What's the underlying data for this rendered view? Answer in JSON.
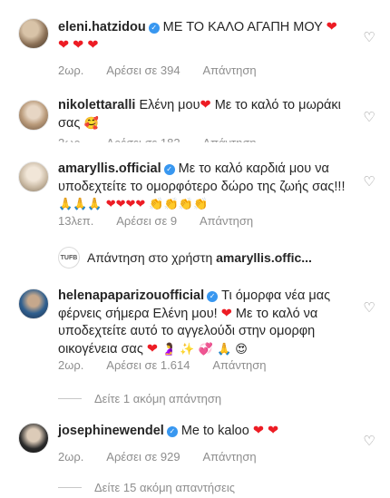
{
  "comments": [
    {
      "username": "eleni.hatzidou",
      "text": "ΜΕ ΤΟ ΚΑΛΟ ΑΓΑΠΗ ΜΟΥ",
      "emoji_trail": "❤ ❤❤❤",
      "time": "2ωρ.",
      "likes": "Αρέσει σε 394",
      "reply": "Απάντηση"
    },
    {
      "username": "nikolettaralli",
      "text": "Ελένη μου",
      "text2": "Με το καλό το μωράκι σας",
      "emoji_trail": "",
      "time": "2ωρ.",
      "likes": "Αρέσει σε 182",
      "reply": "Απάντηση"
    },
    {
      "username": "amaryllis.official",
      "text": "Με το καλό καρδιά μου να υποδεχτείτε το ομορφότερο δώρο της ζωής σας!!!",
      "emoji_trail": "🙏🙏🙏 ❤❤❤❤ 👏👏👏👏",
      "time": "13λεπ.",
      "likes": "Αρέσει σε 9",
      "reply": "Απάντηση"
    },
    {
      "username": "helenapaparizouofficial",
      "text": "Τι όμορφα νέα μας φέρνεις σήμερα Ελένη μου!",
      "text2": "Με το καλό να υποδεχτείτε αυτό το αγγελούδι στην ομορφη οικογένεια σας",
      "emoji_trail": "🤰 ✨ 💞 🙏 😍",
      "time": "2ωρ.",
      "likes": "Αρέσει σε 1.614",
      "reply": "Απάντηση"
    },
    {
      "username": "josephinewendel",
      "text": "Me to kaloo",
      "emoji_trail": "",
      "time": "2ωρ.",
      "likes": "Αρέσει σε 929",
      "reply": "Απάντηση"
    }
  ],
  "reply_prompt": {
    "prefix": "Απάντηση στο χρήστη",
    "target": "amaryllis.offic...",
    "avatar_label": "TUFB"
  },
  "more_replies": [
    "Δείτε 1 ακόμη απάντηση",
    "Δείτε 15 ακόμη απαντήσεις"
  ],
  "icons": {
    "like": "heart-outline-icon",
    "verified": "verified-badge-icon"
  },
  "colors": {
    "text": "#262626",
    "muted": "#8e8e8e",
    "verified": "#3897f0",
    "heart": "#ed1c24"
  }
}
